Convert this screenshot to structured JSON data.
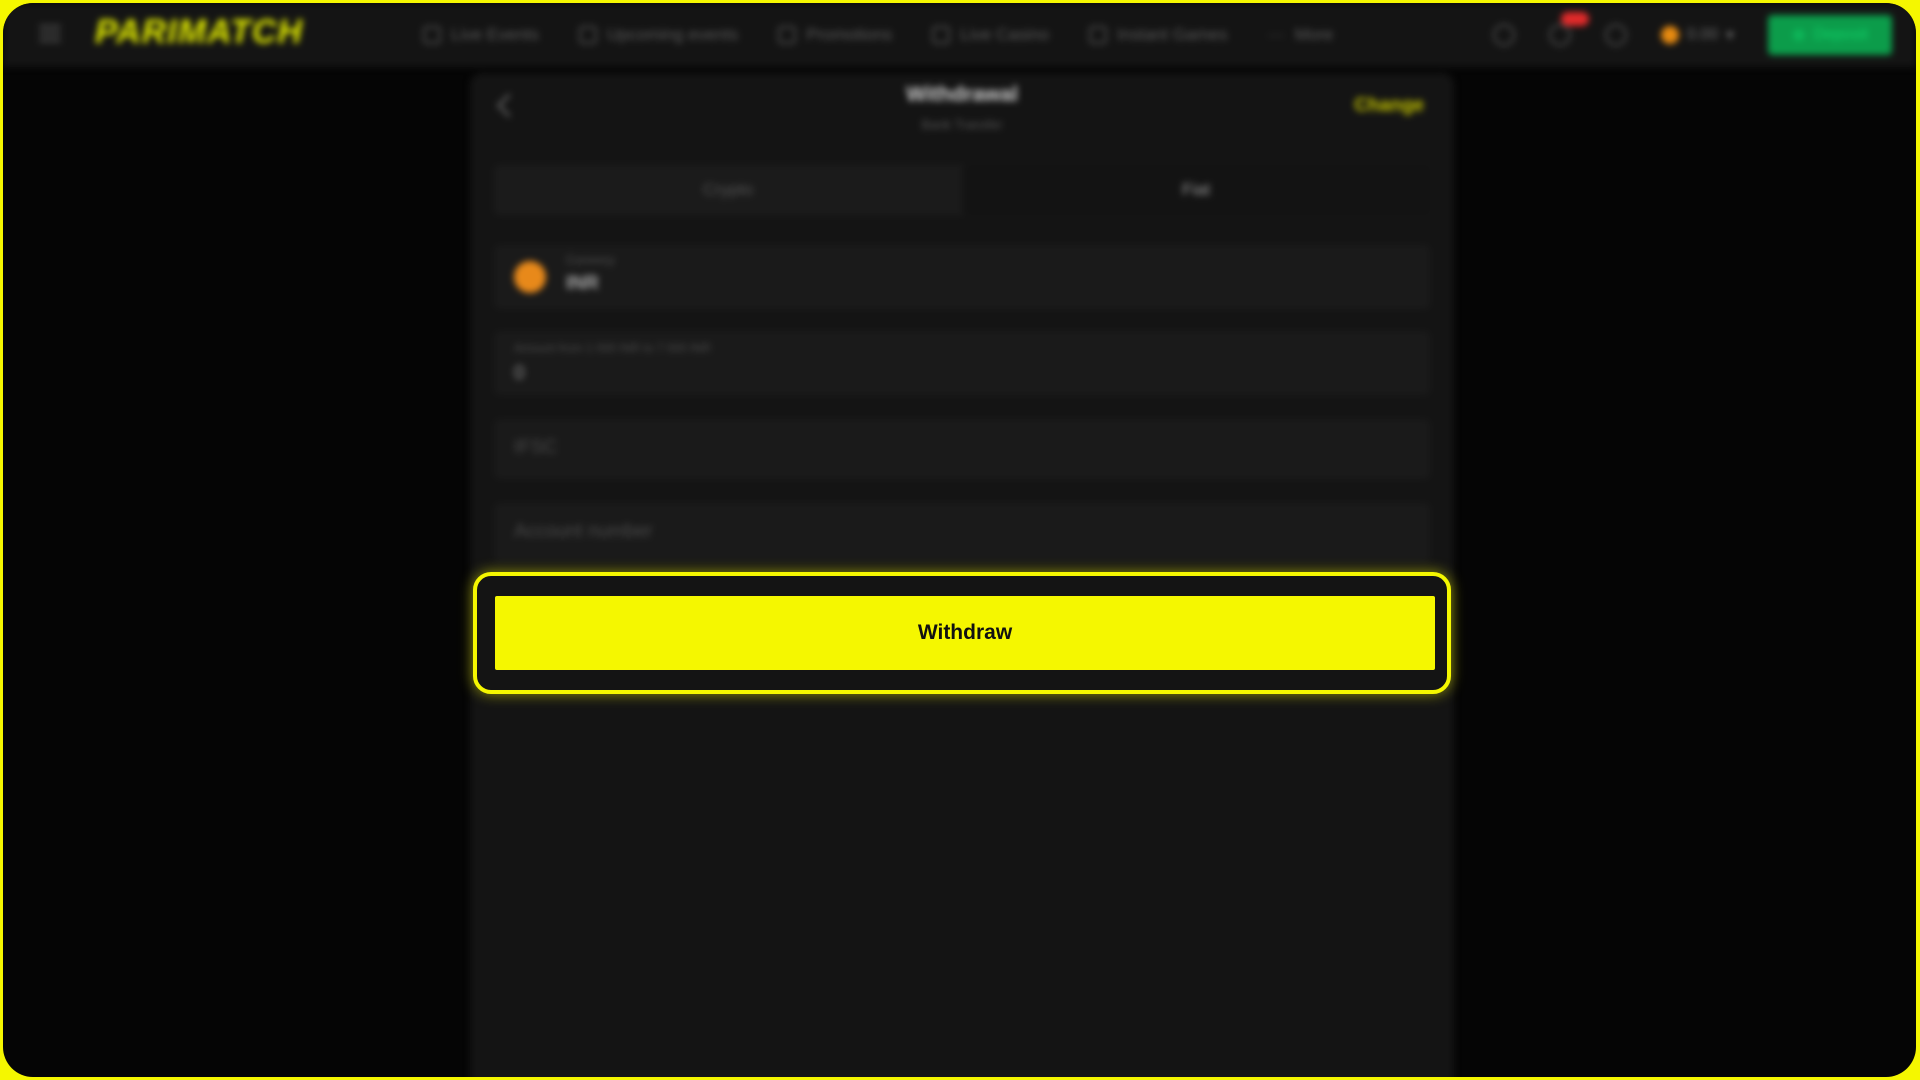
{
  "brand": {
    "logo_text": "PARIMATCH",
    "accent_color": "#f5f700",
    "deposit_color": "#0c9c4a"
  },
  "nav": {
    "items": [
      {
        "label": "Live Events",
        "icon": "tv-icon"
      },
      {
        "label": "Upcoming events",
        "icon": "calendar-icon"
      },
      {
        "label": "Promotions",
        "icon": "gift-icon"
      },
      {
        "label": "Live Casino",
        "icon": "diamond-icon"
      },
      {
        "label": "Instant Games",
        "icon": "rocket-icon"
      },
      {
        "label": "More",
        "icon": "dots-icon"
      }
    ]
  },
  "header": {
    "balance": "0.00",
    "deposit_label": "Deposit"
  },
  "panel": {
    "title": "Withdrawal",
    "subtitle": "Bank Transfer",
    "change_label": "Change",
    "tabs": [
      {
        "label": "Crypto"
      },
      {
        "label": "Fiat"
      }
    ],
    "currency": {
      "caption": "Currency",
      "value": "INR"
    },
    "amount": {
      "caption": "Amount from 1 000 INR to 7 000 INR",
      "value": "0"
    },
    "ifsc_placeholder": "IFSC",
    "account_placeholder": "Account number",
    "withdraw_label": "Withdraw"
  }
}
